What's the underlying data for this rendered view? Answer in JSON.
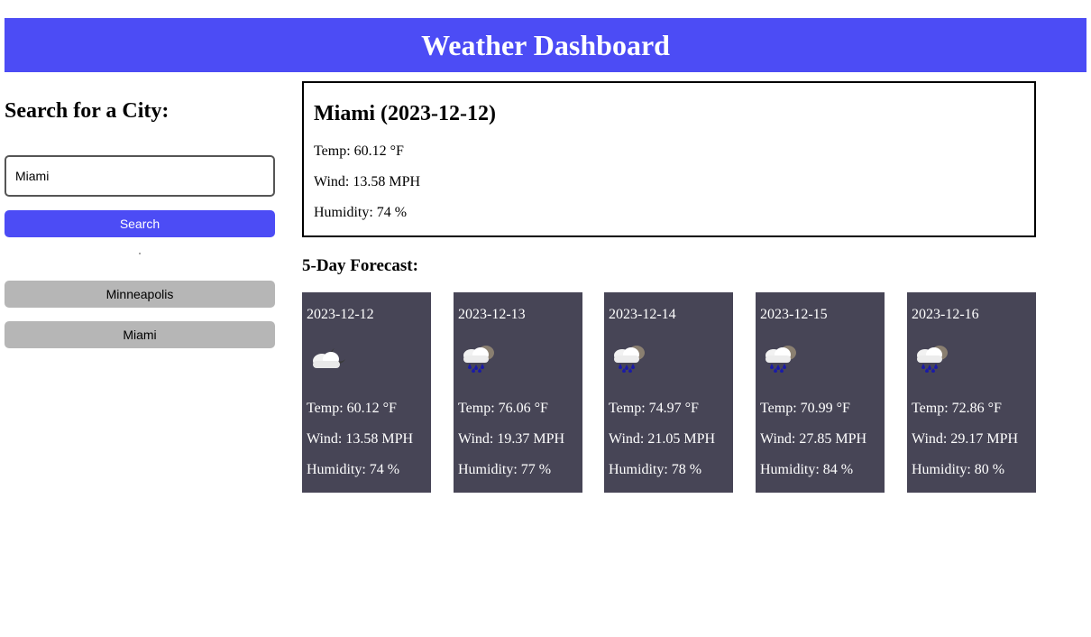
{
  "header": {
    "title": "Weather Dashboard"
  },
  "sidebar": {
    "heading": "Search for a City:",
    "search_value": "Miami",
    "search_button_label": "Search",
    "history": [
      "Minneapolis",
      "Miami"
    ]
  },
  "current": {
    "title": "Miami (2023-12-12)",
    "temp": "Temp: 60.12 °F",
    "wind": "Wind: 13.58 MPH",
    "humidity": "Humidity: 74 %"
  },
  "forecast": {
    "title": "5-Day Forecast:",
    "days": [
      {
        "date": "2023-12-12",
        "icon": "partly-cloudy-night-icon",
        "temp": "Temp: 60.12 °F",
        "wind": "Wind: 13.58 MPH",
        "humidity": "Humidity: 74 %"
      },
      {
        "date": "2023-12-13",
        "icon": "rain-cloud-icon",
        "temp": "Temp: 76.06 °F",
        "wind": "Wind: 19.37 MPH",
        "humidity": "Humidity: 77 %"
      },
      {
        "date": "2023-12-14",
        "icon": "rain-cloud-icon",
        "temp": "Temp: 74.97 °F",
        "wind": "Wind: 21.05 MPH",
        "humidity": "Humidity: 78 %"
      },
      {
        "date": "2023-12-15",
        "icon": "rain-cloud-icon",
        "temp": "Temp: 70.99 °F",
        "wind": "Wind: 27.85 MPH",
        "humidity": "Humidity: 84 %"
      },
      {
        "date": "2023-12-16",
        "icon": "rain-cloud-icon",
        "temp": "Temp: 72.86 °F",
        "wind": "Wind: 29.17 MPH",
        "humidity": "Humidity: 80 %"
      }
    ]
  },
  "colors": {
    "accent": "#4c4cf5",
    "card_bg": "#474556",
    "history_bg": "#b6b6b6"
  }
}
